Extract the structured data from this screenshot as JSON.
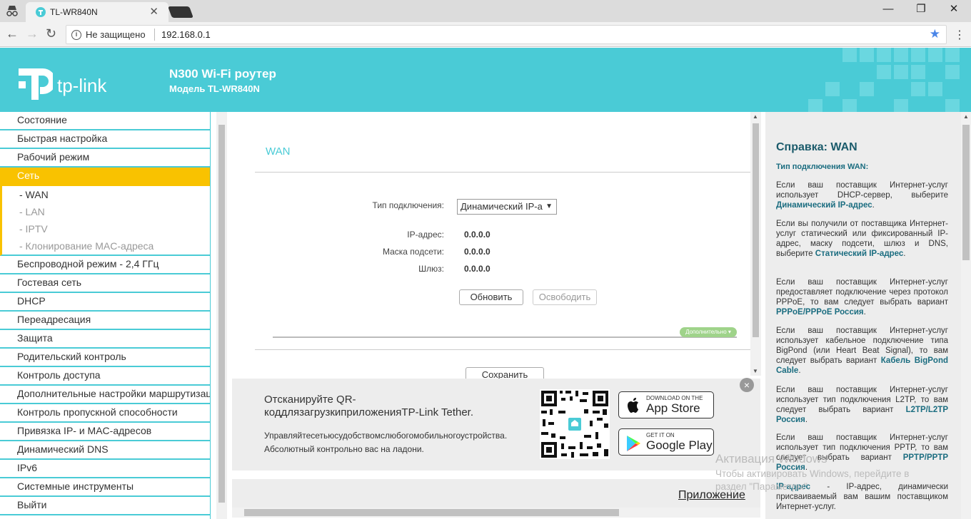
{
  "browser": {
    "tab_title": "TL-WR840N",
    "tab_close": "✕",
    "security_label": "Не защищено",
    "url": "192.168.0.1",
    "win_minimize": "—",
    "win_restore": "❐",
    "win_close": "✕"
  },
  "header": {
    "brand": "tp-link",
    "product": "N300 Wi-Fi роутер",
    "model": "Модель TL-WR840N",
    "colors": {
      "accent": "#4acbd6",
      "active": "#f9c200"
    }
  },
  "sidebar": {
    "items_before": [
      "Состояние",
      "Быстрая настройка",
      "Рабочий режим"
    ],
    "active": "Сеть",
    "subitems": [
      "- WAN",
      "- LAN",
      "- IPTV",
      "- Клонирование MAC-адреса"
    ],
    "items_after": [
      "Беспроводной режим - 2,4 ГГц",
      "Гостевая сеть",
      "DHCP",
      "Переадресация",
      "Защита",
      "Родительский контроль",
      "Контроль доступа",
      "Дополнительные настройки маршрутизации",
      "Контроль пропускной способности",
      "Привязка IP- и MAC-адресов",
      "Динамический DNS",
      "IPv6",
      "Системные инструменты",
      "Выйти"
    ]
  },
  "main": {
    "title": "WAN",
    "connection_type_label": "Тип подключения:",
    "connection_type_value": "Динамический IP-а",
    "ip_label": "IP-адрес:",
    "ip_value": "0.0.0.0",
    "mask_label": "Маска подсети:",
    "mask_value": "0.0.0.0",
    "gateway_label": "Шлюз:",
    "gateway_value": "0.0.0.0",
    "renew_button": "Обновить",
    "release_button": "Освободить",
    "advanced_label": "Дополнительно",
    "save_button": "Сохранить"
  },
  "promo": {
    "title": "Отсканируйте QR-коддлязагрузкиприложенияTP-Link Tether.",
    "line1": "Управляйтесетьюсудобствомслюбогомобильногоустройства.",
    "line2": "Абсолютный контрольно вас на ладони.",
    "appstore_small": "DOWNLOAD ON THE",
    "appstore_big": "App Store",
    "gplay_small": "GET IT ON",
    "gplay_big": "Google Play",
    "close": "×",
    "app_link": "Приложение"
  },
  "help": {
    "title": "Справка: WAN",
    "subtitle": "Тип подключения WAN:",
    "p1_text": "Если ваш поставщик Интернет-услуг использует DHCP-сервер, выберите ",
    "p1_bold": "Динамический IP-адрес",
    "p2_text": "Если вы получили от поставщика Интернет-услуг статический или фиксированный IP-адрес, маску подсети, шлюз и DNS, выберите ",
    "p2_bold": "Статический IP-адрес",
    "p3_text": "Если ваш поставщик Интернет-услуг предоставляет подключение через протокол PPPoE, то вам следует выбрать вариант ",
    "p3_bold": "PPPoE/PPPoE Россия",
    "p4_text": "Если ваш поставщик Интернет-услуг использует кабельное подключение типа BigPond (или Heart Beat Signal), то вам следует выбрать вариант ",
    "p4_bold": "Кабель BigPond Cable",
    "p5_text": "Если ваш поставщик Интернет-услуг использует тип подключения L2TP, то вам следует выбрать вариант ",
    "p5_bold": "L2TP/L2TP Россия",
    "p6_text": "Если ваш поставщик Интернет-услуг использует тип подключения PPTP, то вам следует выбрать вариант ",
    "p6_bold": "PPTP/PPTP Россия",
    "p7_bold": "IP-адрес",
    "p7_text": " - IP-адрес, динамически присваиваемый вам вашим поставщиком Интернет-услуг."
  },
  "watermark": {
    "line1": "Активация Windows",
    "line2": "Чтобы активировать Windows, перейдите в",
    "line3": "раздел \"Параметры\"."
  }
}
